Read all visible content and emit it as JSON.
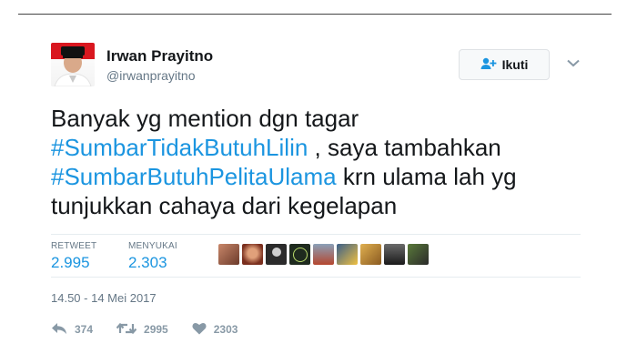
{
  "tweet": {
    "author_name": "Irwan Prayitno",
    "author_handle": "@irwanprayitno",
    "follow_label": "Ikuti",
    "text_parts": [
      "Banyak yg mention dgn tagar",
      "#SumbarTidakButuhLilin",
      " , saya tambahkan",
      "#SumbarButuhPelitaUlama",
      " krn ulama lah yg",
      "tunjukkan cahaya dari kegelapan"
    ],
    "stats": {
      "retweet_label": "RETWEET",
      "retweet_count": "2.995",
      "like_label": "MENYUKAI",
      "like_count": "2.303"
    },
    "timestamp": "14.50 - 14 Mei 2017",
    "actions": {
      "reply_count": "374",
      "retweet_count": "2995",
      "like_count": "2303"
    }
  },
  "colors": {
    "link": "#1b95e0",
    "muted": "#657786",
    "text": "#14171a"
  },
  "icons": [
    "avatar",
    "add-user-icon",
    "chevron-down-icon",
    "reply-icon",
    "retweet-icon",
    "heart-icon"
  ]
}
